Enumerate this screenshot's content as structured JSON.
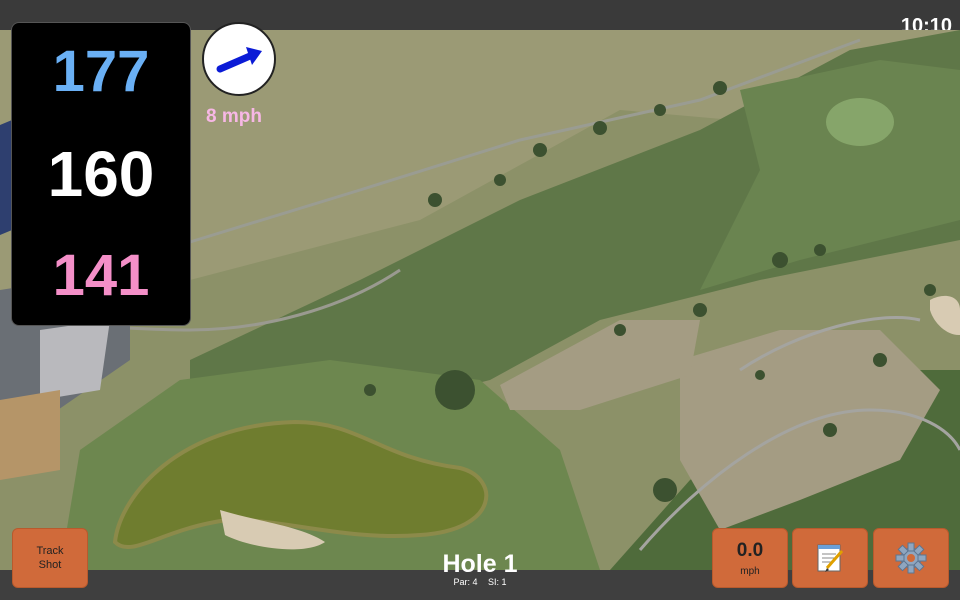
{
  "status": {
    "time": "10:10"
  },
  "distances": {
    "back": "177",
    "middle": "160",
    "front": "141"
  },
  "wind": {
    "speed": "8 mph",
    "direction_icon": "wind-arrow-icon"
  },
  "hole": {
    "title": "Hole 1",
    "par": "Par: 4",
    "stroke_index": "SI: 1"
  },
  "buttons": {
    "track_shot": "Track Shot",
    "speed_value": "0.0",
    "speed_unit": "mph",
    "notes_icon": "notepad-icon",
    "settings_icon": "gear-icon"
  },
  "colors": {
    "button_orange": "#d06a3a",
    "back_distance": "#6ab0f5",
    "middle_distance": "#ffffff",
    "front_distance": "#f48fc8",
    "wind_text": "#f7b7e5"
  }
}
